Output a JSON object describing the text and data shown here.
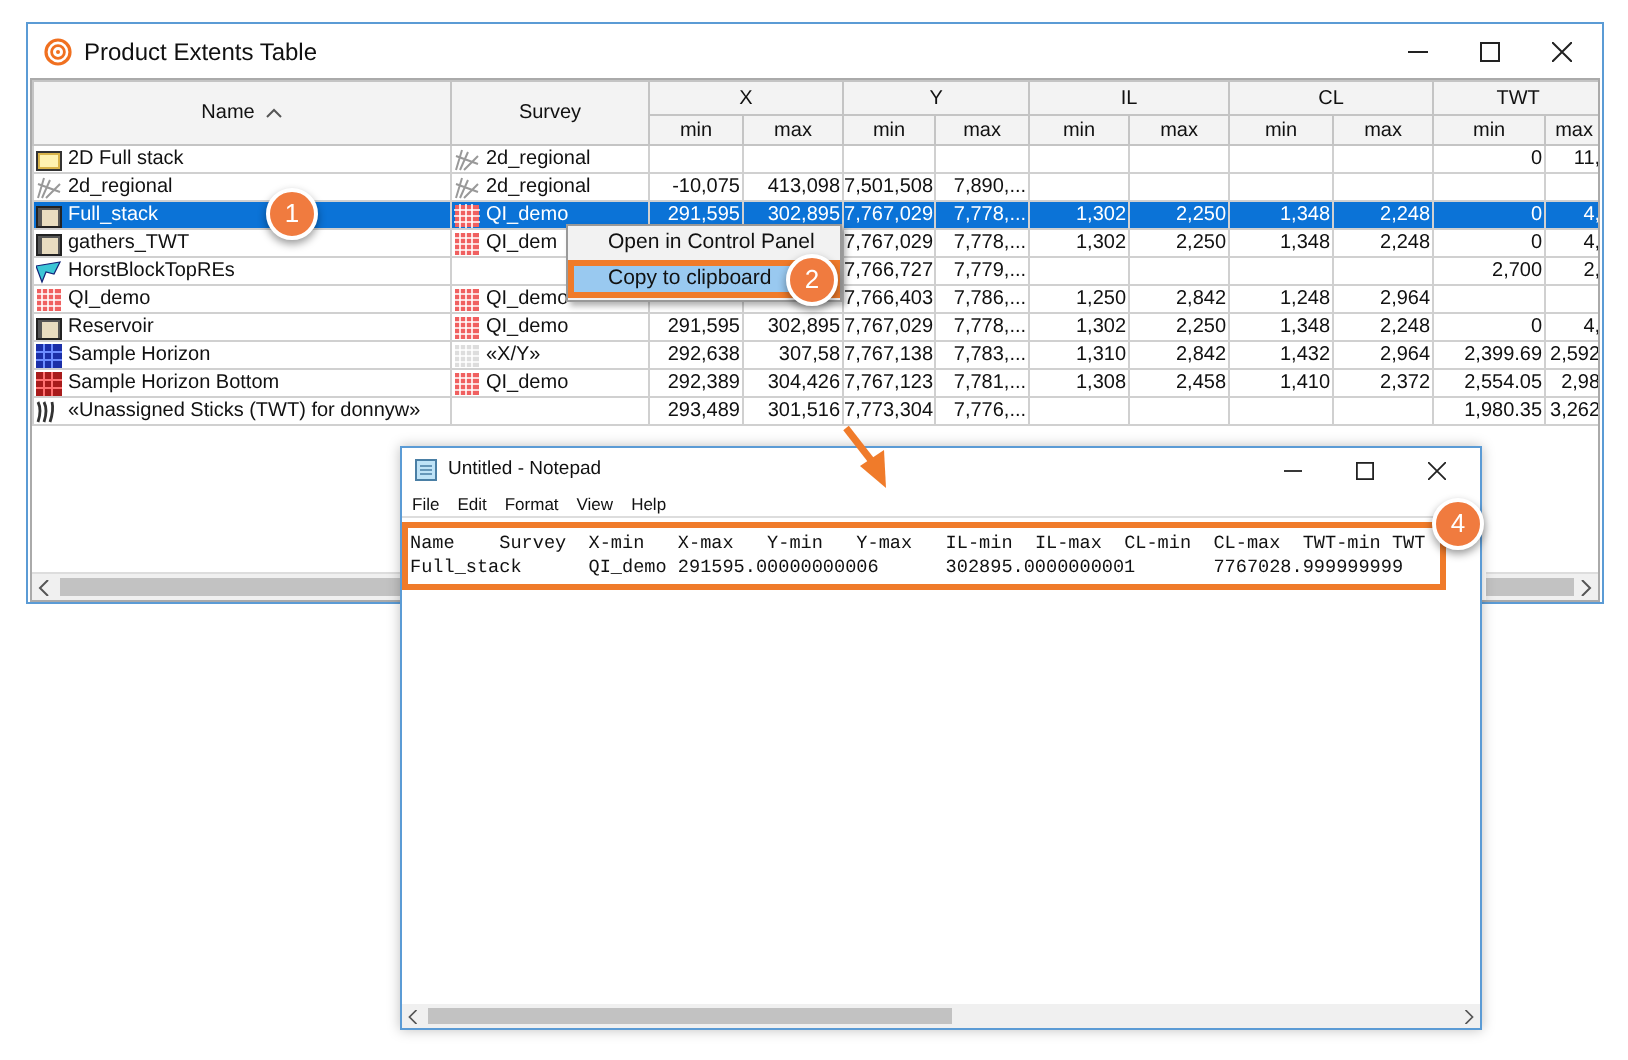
{
  "window": {
    "title": "Product Extents Table"
  },
  "table": {
    "name_column": {
      "label": "Name",
      "sorted_ascending": true
    },
    "survey_column": {
      "label": "Survey"
    },
    "groups": [
      {
        "label": "X",
        "sub": [
          "min",
          "max"
        ]
      },
      {
        "label": "Y",
        "sub": [
          "min",
          "max"
        ]
      },
      {
        "label": "IL",
        "sub": [
          "min",
          "max"
        ]
      },
      {
        "label": "CL",
        "sub": [
          "min",
          "max"
        ]
      },
      {
        "label": "TWT",
        "sub": [
          "min",
          "max"
        ]
      }
    ],
    "rows": [
      {
        "name": "2D Full stack",
        "kind": "seismic-2d",
        "survey": {
          "name": "2d_regional",
          "kind": "survey-2d"
        },
        "selected": false,
        "twt_min": "0",
        "twt_max": "11,"
      },
      {
        "name": "2d_regional",
        "kind": "survey-2d",
        "survey": {
          "name": "2d_regional",
          "kind": "survey-2d"
        },
        "selected": false,
        "x_min": "-10,075",
        "x_max": "413,098",
        "y_min": "7,501,508",
        "y_max": "7,890,..."
      },
      {
        "name": "Full_stack",
        "kind": "seismic-3d",
        "survey": {
          "name": "QI_demo",
          "kind": "survey-3d"
        },
        "selected": true,
        "x_min": "291,595",
        "x_max": "302,895",
        "y_min": "7,767,029",
        "y_max": "7,778,...",
        "il_min": "1,302",
        "il_max": "2,250",
        "cl_min": "1,348",
        "cl_max": "2,248",
        "twt_min": "0",
        "twt_max": "4,"
      },
      {
        "name": "gathers_TWT",
        "kind": "seismic-3d",
        "survey": {
          "name": "QI_dem",
          "kind": "survey-3d"
        },
        "selected": false,
        "y_min": "7,767,029",
        "y_max": "7,778,...",
        "il_min": "1,302",
        "il_max": "2,250",
        "cl_min": "1,348",
        "cl_max": "2,248",
        "twt_min": "0",
        "twt_max": "4,"
      },
      {
        "name": "HorstBlockTopREs",
        "kind": "horizon-2d",
        "selected": false,
        "y_min": "7,766,727",
        "y_max": "7,779,...",
        "twt_min": "2,700",
        "twt_max": "2,"
      },
      {
        "name": "QI_demo",
        "kind": "survey-3d",
        "survey": {
          "name": "QI_demo",
          "kind": "survey-3d"
        },
        "selected": false,
        "y_min": "7,766,403",
        "y_max": "7,786,...",
        "il_min": "1,250",
        "il_max": "2,842",
        "cl_min": "1,248",
        "cl_max": "2,964"
      },
      {
        "name": "Reservoir",
        "kind": "seismic-3d",
        "survey": {
          "name": "QI_demo",
          "kind": "survey-3d"
        },
        "selected": false,
        "x_min": "291,595",
        "x_max": "302,895",
        "y_min": "7,767,029",
        "y_max": "7,778,...",
        "il_min": "1,302",
        "il_max": "2,250",
        "cl_min": "1,348",
        "cl_max": "2,248",
        "twt_min": "0",
        "twt_max": "4,"
      },
      {
        "name": "Sample Horizon",
        "kind": "horizon-blue",
        "survey": {
          "name": "«X/Y»",
          "kind": "survey-xy"
        },
        "selected": false,
        "x_min": "292,638",
        "x_max": "307,58",
        "y_min": "7,767,138",
        "y_max": "7,783,...",
        "il_min": "1,310",
        "il_max": "2,842",
        "cl_min": "1,432",
        "cl_max": "2,964",
        "twt_min": "2,399.69",
        "twt_max": "2,592"
      },
      {
        "name": "Sample Horizon Bottom",
        "kind": "horizon-red",
        "survey": {
          "name": "QI_demo",
          "kind": "survey-3d"
        },
        "selected": false,
        "x_min": "292,389",
        "x_max": "304,426",
        "y_min": "7,767,123",
        "y_max": "7,781,...",
        "il_min": "1,308",
        "il_max": "2,458",
        "cl_min": "1,410",
        "cl_max": "2,372",
        "twt_min": "2,554.05",
        "twt_max": "2,98"
      },
      {
        "name": "«Unassigned Sticks (TWT) for donnyw»",
        "kind": "sticks",
        "selected": false,
        "x_min": "293,489",
        "x_max": "301,516",
        "y_min": "7,773,304",
        "y_max": "7,776,...",
        "twt_min": "1,980.35",
        "twt_max": "3,262"
      }
    ]
  },
  "context_menu": {
    "items": [
      {
        "label": "Open in Control Panel",
        "selected": false
      },
      {
        "label": "Copy to clipboard",
        "selected": true
      }
    ]
  },
  "notepad": {
    "title": "Untitled - Notepad",
    "menu": [
      "File",
      "Edit",
      "Format",
      "View",
      "Help"
    ],
    "lines": [
      "Name\tSurvey\tX-min\tX-max\tY-min\tY-max\tIL-min\tIL-max\tCL-min\tCL-max\tTWT-min\tTWT",
      "Full_stack\tQI_demo\t291595.00000000006\t302895.0000000001\t7767028.999999999"
    ]
  },
  "callouts": [
    {
      "label": "1"
    },
    {
      "label": "2"
    },
    {
      "label": "4"
    }
  ]
}
